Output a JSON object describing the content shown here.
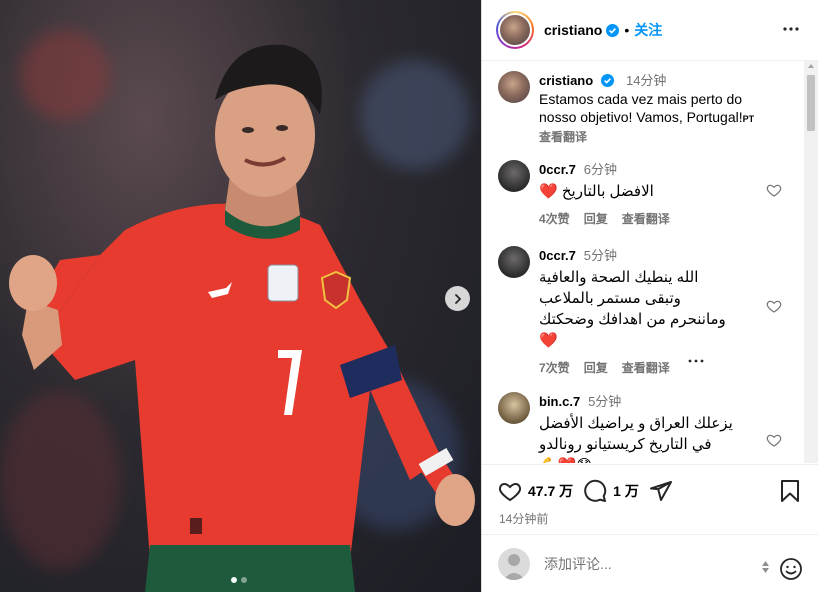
{
  "post": {
    "author": "cristiano",
    "follow_label": "关注",
    "separator": "•",
    "carousel": {
      "slides": 2,
      "active": 1
    }
  },
  "caption": {
    "username": "cristiano",
    "time": "14分钟",
    "text": "Estamos cada vez mais perto do nosso objetivo! Vamos, Portugal!",
    "lang_tag": "PT",
    "translate_label": "查看翻译"
  },
  "comments": [
    {
      "username": "0ccr.7",
      "time": "6分钟",
      "text": "الافضل بالتاريخ",
      "emoji": "❤️",
      "likes": "4次赞",
      "reply": "回复",
      "translate": "查看翻译"
    },
    {
      "username": "0ccr.7",
      "time": "5分钟",
      "lines": [
        "الله ينطيك الصحة والعافية",
        "وتبقى مستمر بالملاعب",
        "وماننحرم من اهدافك وضحكتك"
      ],
      "emoji": "❤️",
      "likes": "7次赞",
      "reply": "回复",
      "translate": "查看翻译"
    },
    {
      "username": "bin.c.7",
      "time": "5分钟",
      "lines": [
        "يزعلك العراق و يراضيك الأفضل",
        "في التاريخ كريستيانو رونالدو"
      ],
      "emoji": "😞❤️💪"
    }
  ],
  "actions": {
    "likes": "47.7 万",
    "comments": "1 万",
    "posted": "14分钟前"
  },
  "comment_box": {
    "placeholder": "添加评论..."
  },
  "colors": {
    "link": "#0095f6",
    "muted": "#737373",
    "heart": "#e0245e",
    "kit_red": "#e63b2e"
  }
}
